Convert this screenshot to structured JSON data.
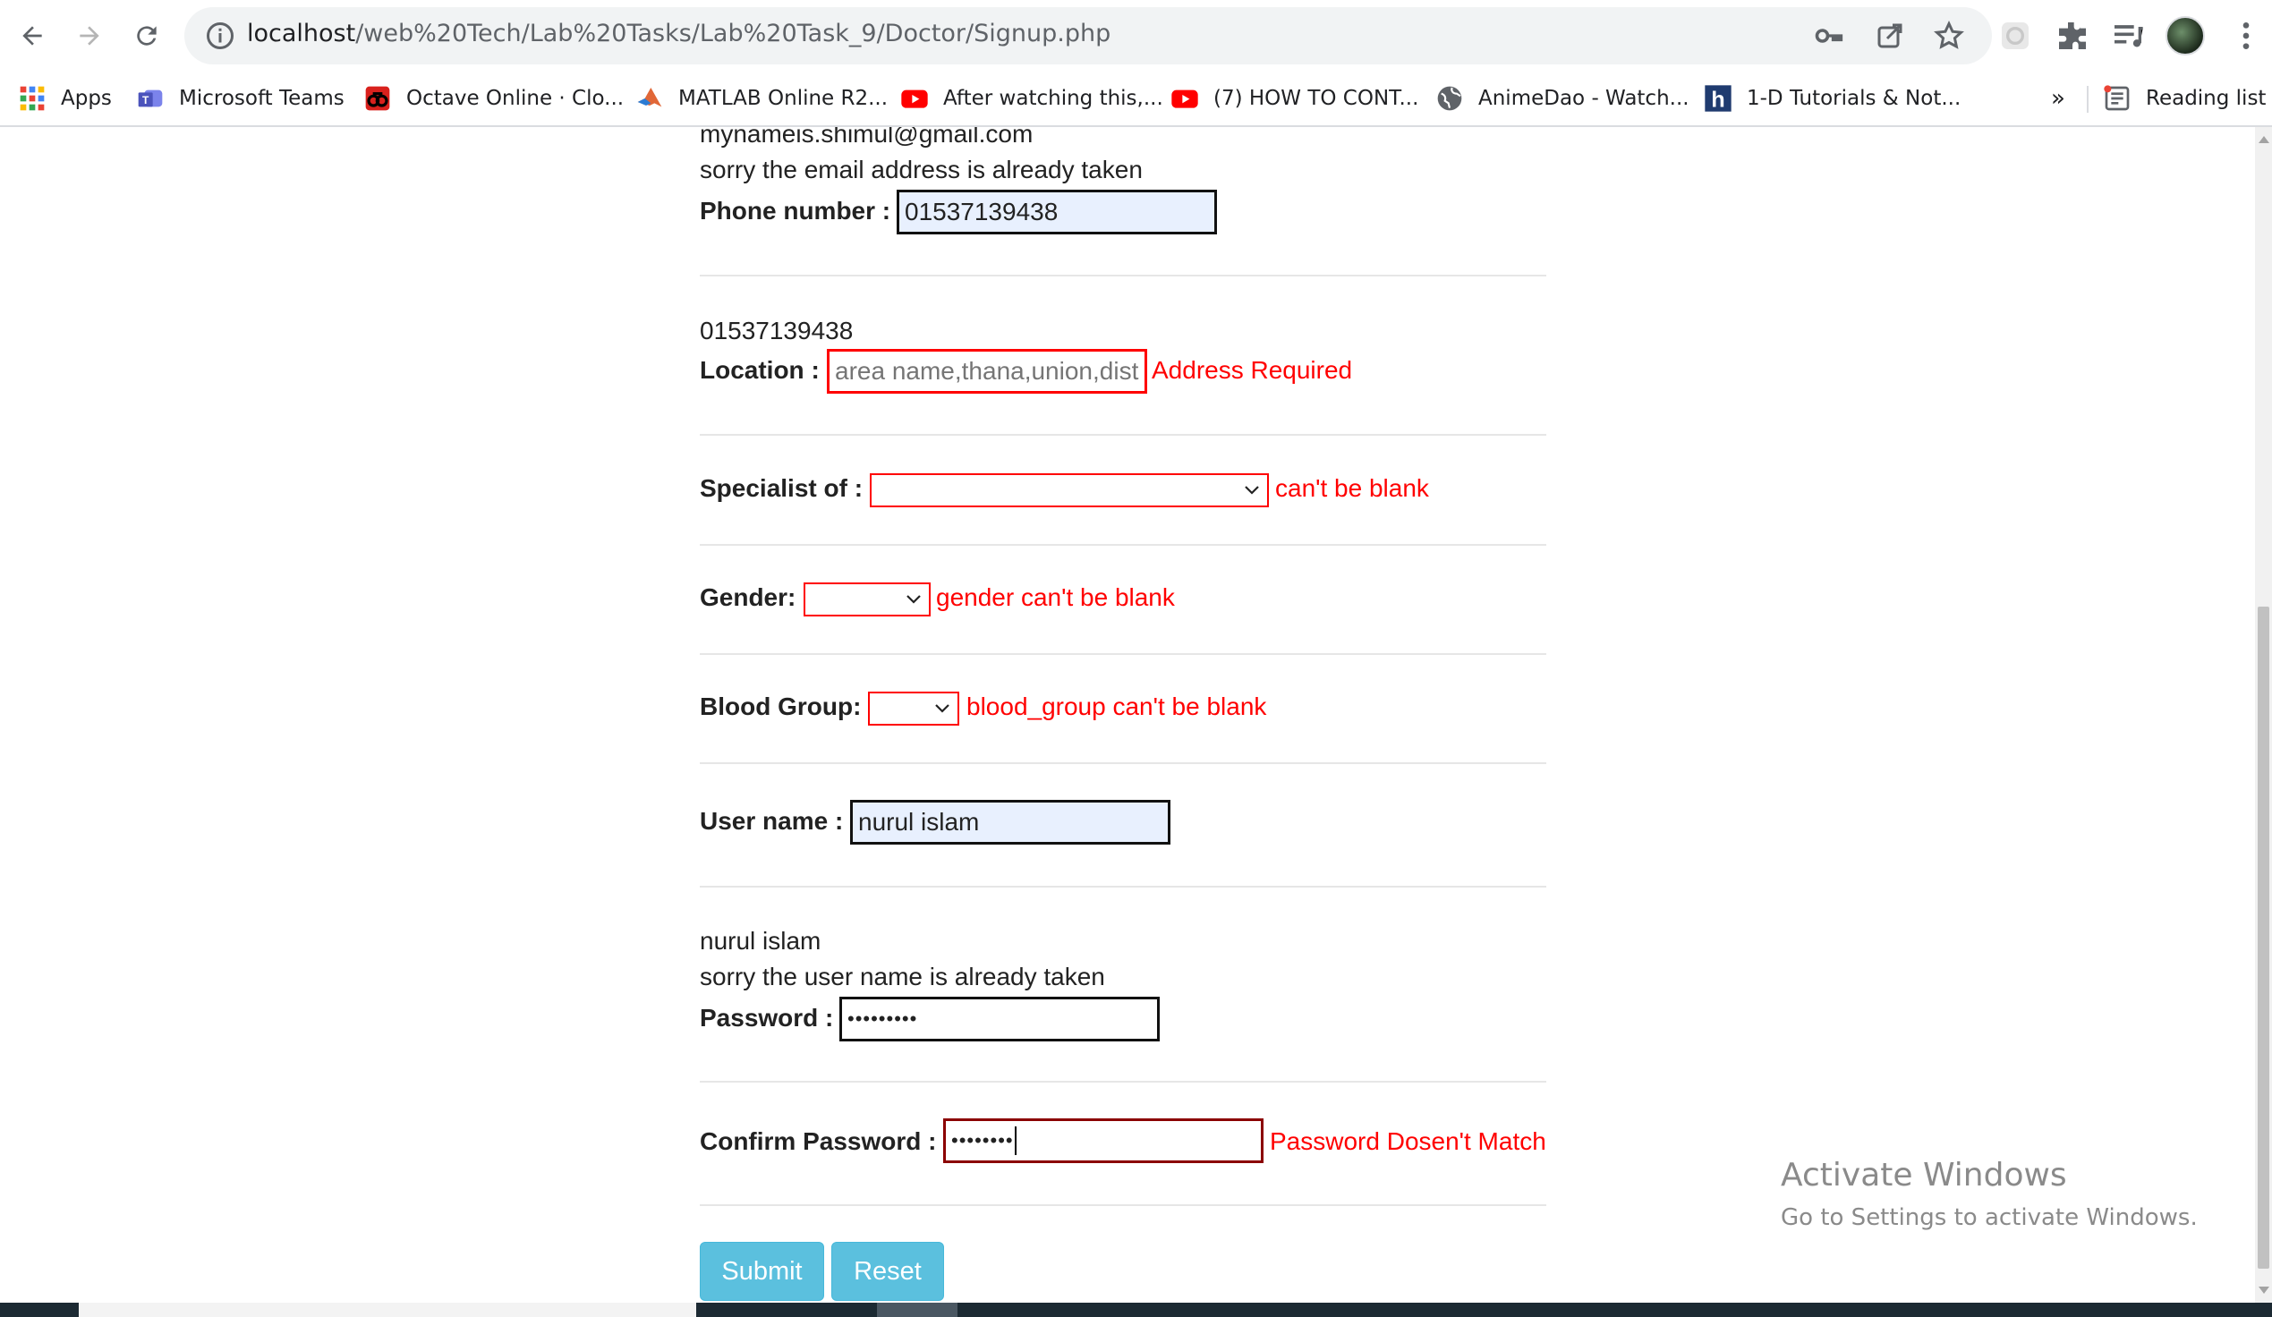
{
  "browser": {
    "url_host": "localhost",
    "url_path": "/web%20Tech/Lab%20Tasks/Lab%20Task_9/Doctor/Signup.php"
  },
  "bookmarks": {
    "items": [
      {
        "label": "Apps",
        "icon": "apps-grid-icon"
      },
      {
        "label": "Microsoft Teams",
        "icon": "teams-icon"
      },
      {
        "label": "Octave Online · Clo...",
        "icon": "octave-icon"
      },
      {
        "label": "MATLAB Online R2...",
        "icon": "matlab-icon"
      },
      {
        "label": "After watching this,...",
        "icon": "youtube-icon"
      },
      {
        "label": "(7) HOW TO CONT...",
        "icon": "youtube-icon"
      },
      {
        "label": "AnimeDao - Watch...",
        "icon": "globe-icon"
      },
      {
        "label": "1-D Tutorials & Not...",
        "icon": "h-icon"
      }
    ],
    "overflow": "»",
    "reading_list": "Reading list"
  },
  "form": {
    "email_echo": "mynameis.shimul@gmail.com",
    "email_error": "sorry the email address is already taken",
    "phone_label": "Phone number :",
    "phone_value": "01537139438",
    "phone_echo": "01537139438",
    "location_label": "Location :",
    "location_placeholder": "area name,thana,union,dist",
    "location_error": "Address Required",
    "specialist_label": "Specialist of :",
    "specialist_error": "can't be blank",
    "gender_label": "Gender:",
    "gender_error": "gender can't be blank",
    "blood_label": "Blood Group:",
    "blood_error": "blood_group can't be blank",
    "username_label": "User name :",
    "username_value": "nurul islam",
    "username_echo": "nurul islam",
    "username_error": "sorry the user name is already taken",
    "password_label": "Password :",
    "password_value": "•••••••••",
    "confirm_label": "Confirm Password :",
    "confirm_value": "••••••••",
    "confirm_error": "Password Dosen't Match",
    "submit_label": "Submit",
    "reset_label": "Reset"
  },
  "watermark": {
    "title": "Activate Windows",
    "subtitle": "Go to Settings to activate Windows."
  },
  "colors": {
    "error": "#ff0000",
    "button": "#5bc0de",
    "autofill": "#e8f0fe"
  }
}
